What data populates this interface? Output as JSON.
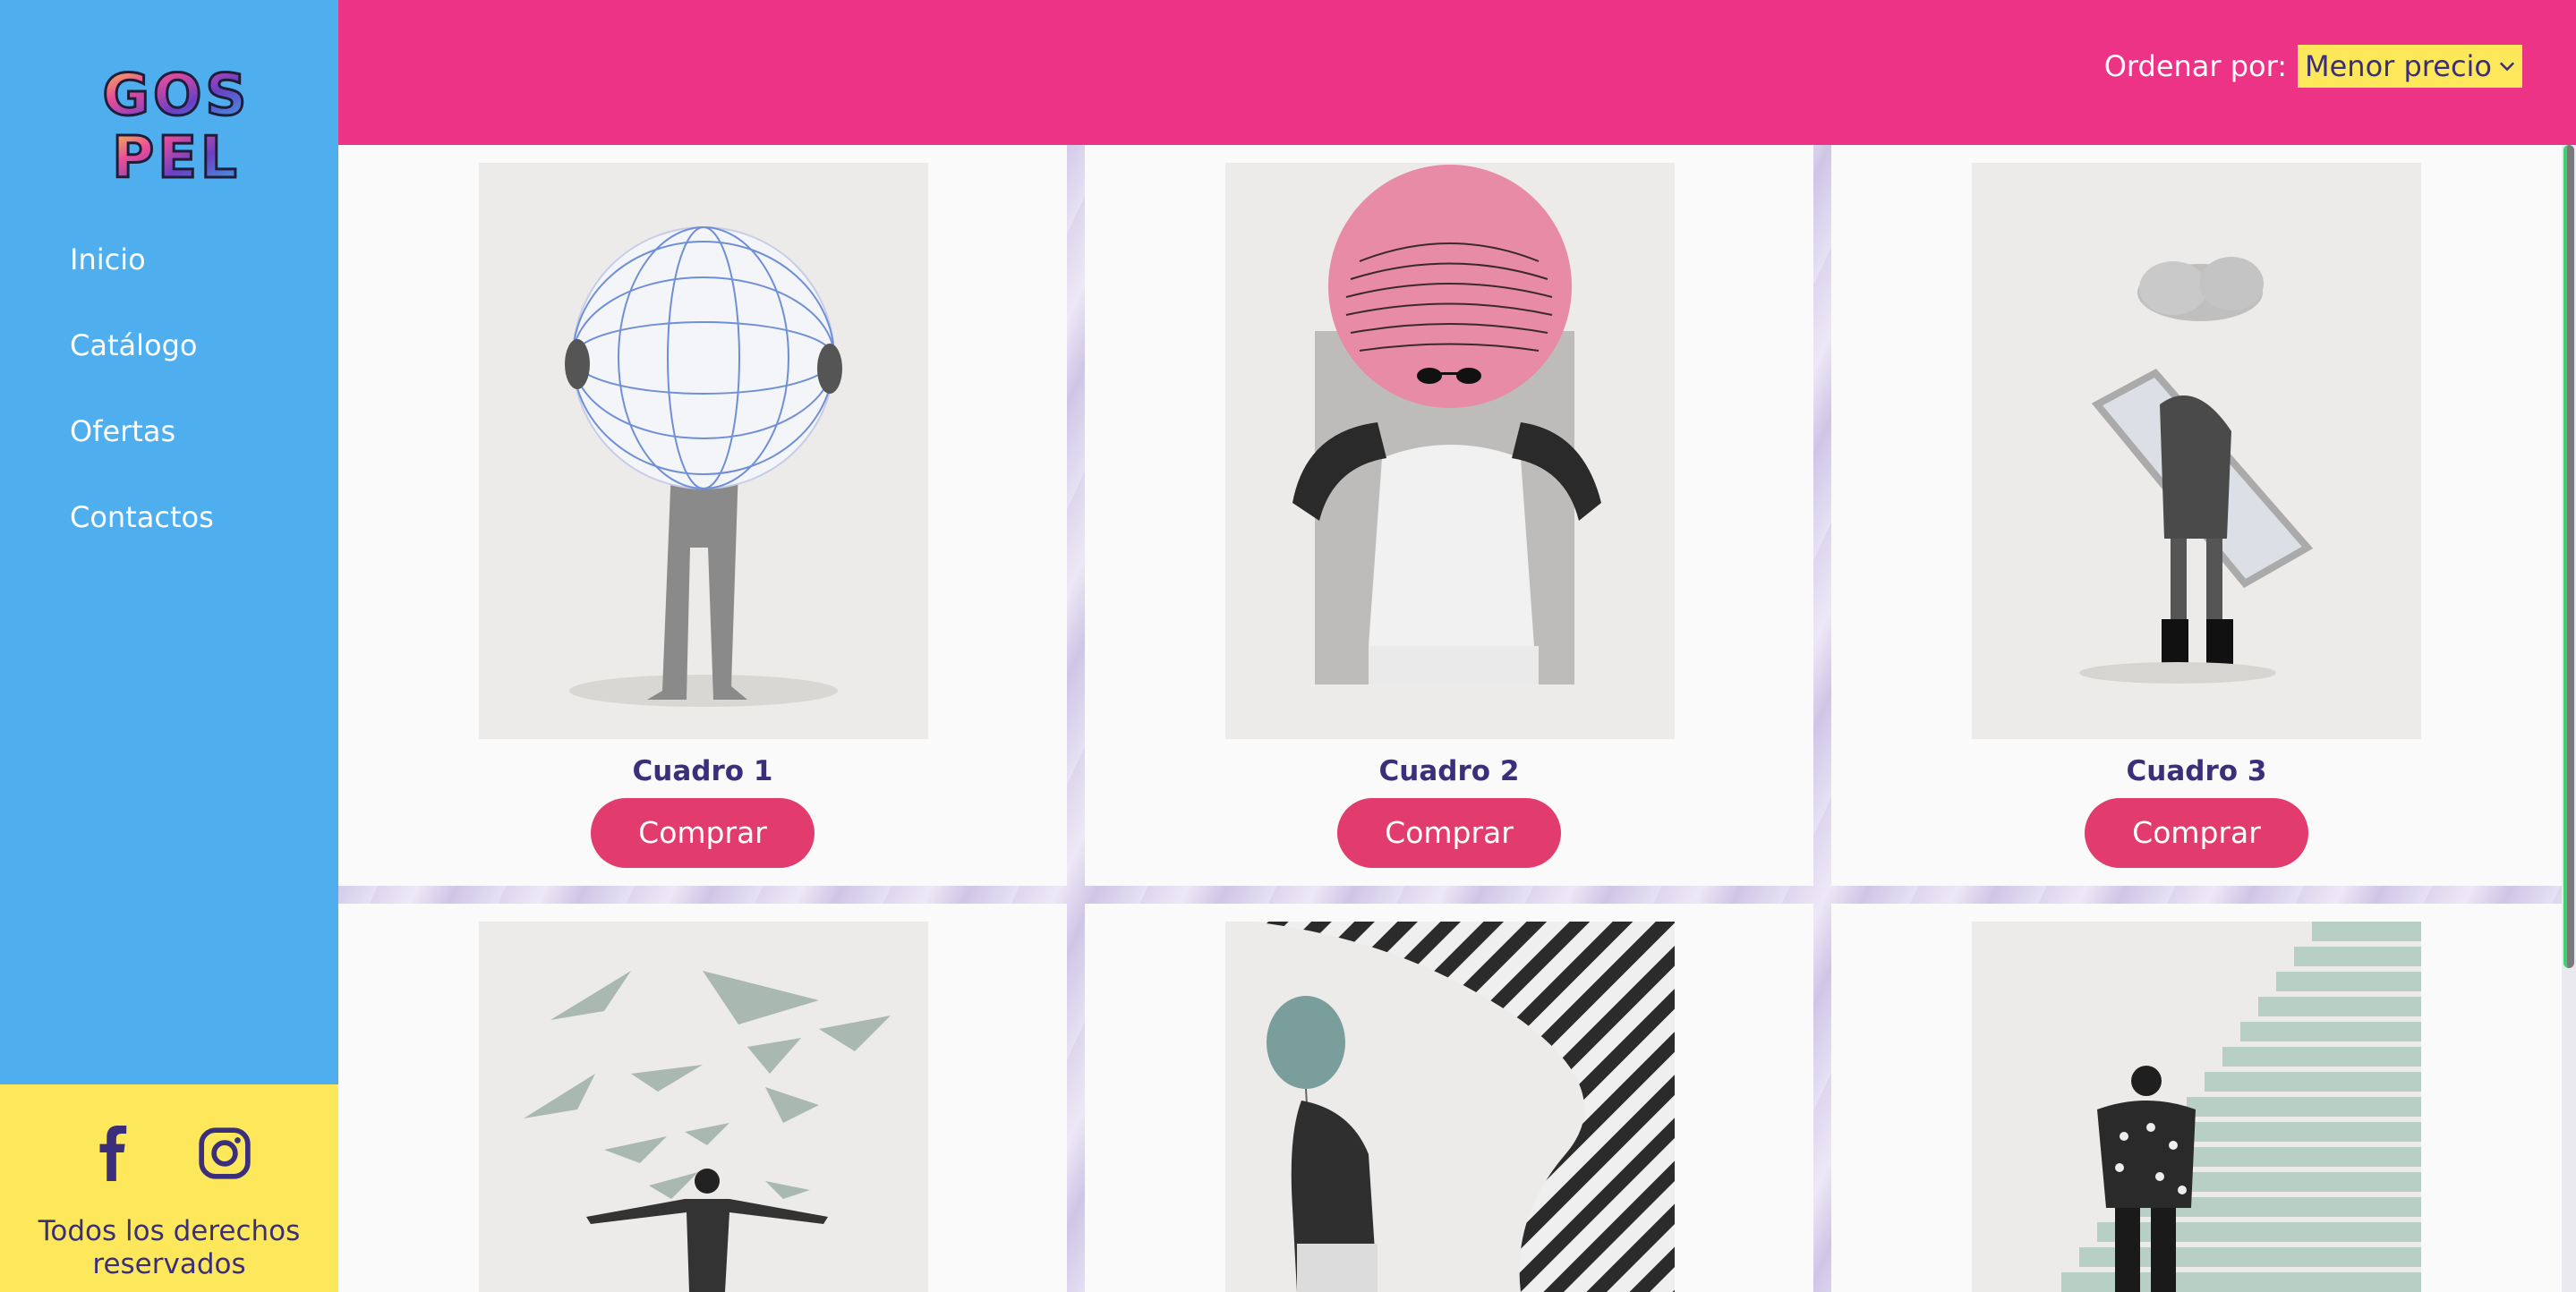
{
  "brand": {
    "logo_text": [
      "GOS",
      "PEL"
    ]
  },
  "nav": {
    "items": [
      {
        "label": "Inicio"
      },
      {
        "label": "Catálogo"
      },
      {
        "label": "Ofertas"
      },
      {
        "label": "Contactos"
      }
    ]
  },
  "footer": {
    "social": [
      "facebook-icon",
      "instagram-icon"
    ],
    "rights_line1": "Todos los derechos",
    "rights_line2": "reservados"
  },
  "sort": {
    "label": "Ordenar por:",
    "selected": "Menor precio"
  },
  "products": [
    {
      "title": "Cuadro 1",
      "button": "Comprar",
      "art": "woman-holding-wireframe-globe"
    },
    {
      "title": "Cuadro 2",
      "button": "Comprar",
      "art": "woman-pink-circle-sunglasses"
    },
    {
      "title": "Cuadro 3",
      "button": "Comprar",
      "art": "person-holding-mirror-cloud"
    },
    {
      "title": "",
      "button": "",
      "art": "man-paper-planes"
    },
    {
      "title": "",
      "button": "",
      "art": "balloon-head-stripes"
    },
    {
      "title": "",
      "button": "",
      "art": "man-walking-stairs"
    }
  ],
  "colors": {
    "sidebar": "#4faeed",
    "topbar": "#ec3386",
    "accent_yellow": "#fce85a",
    "button": "#e23c6e",
    "title_text": "#3b2e7a"
  }
}
